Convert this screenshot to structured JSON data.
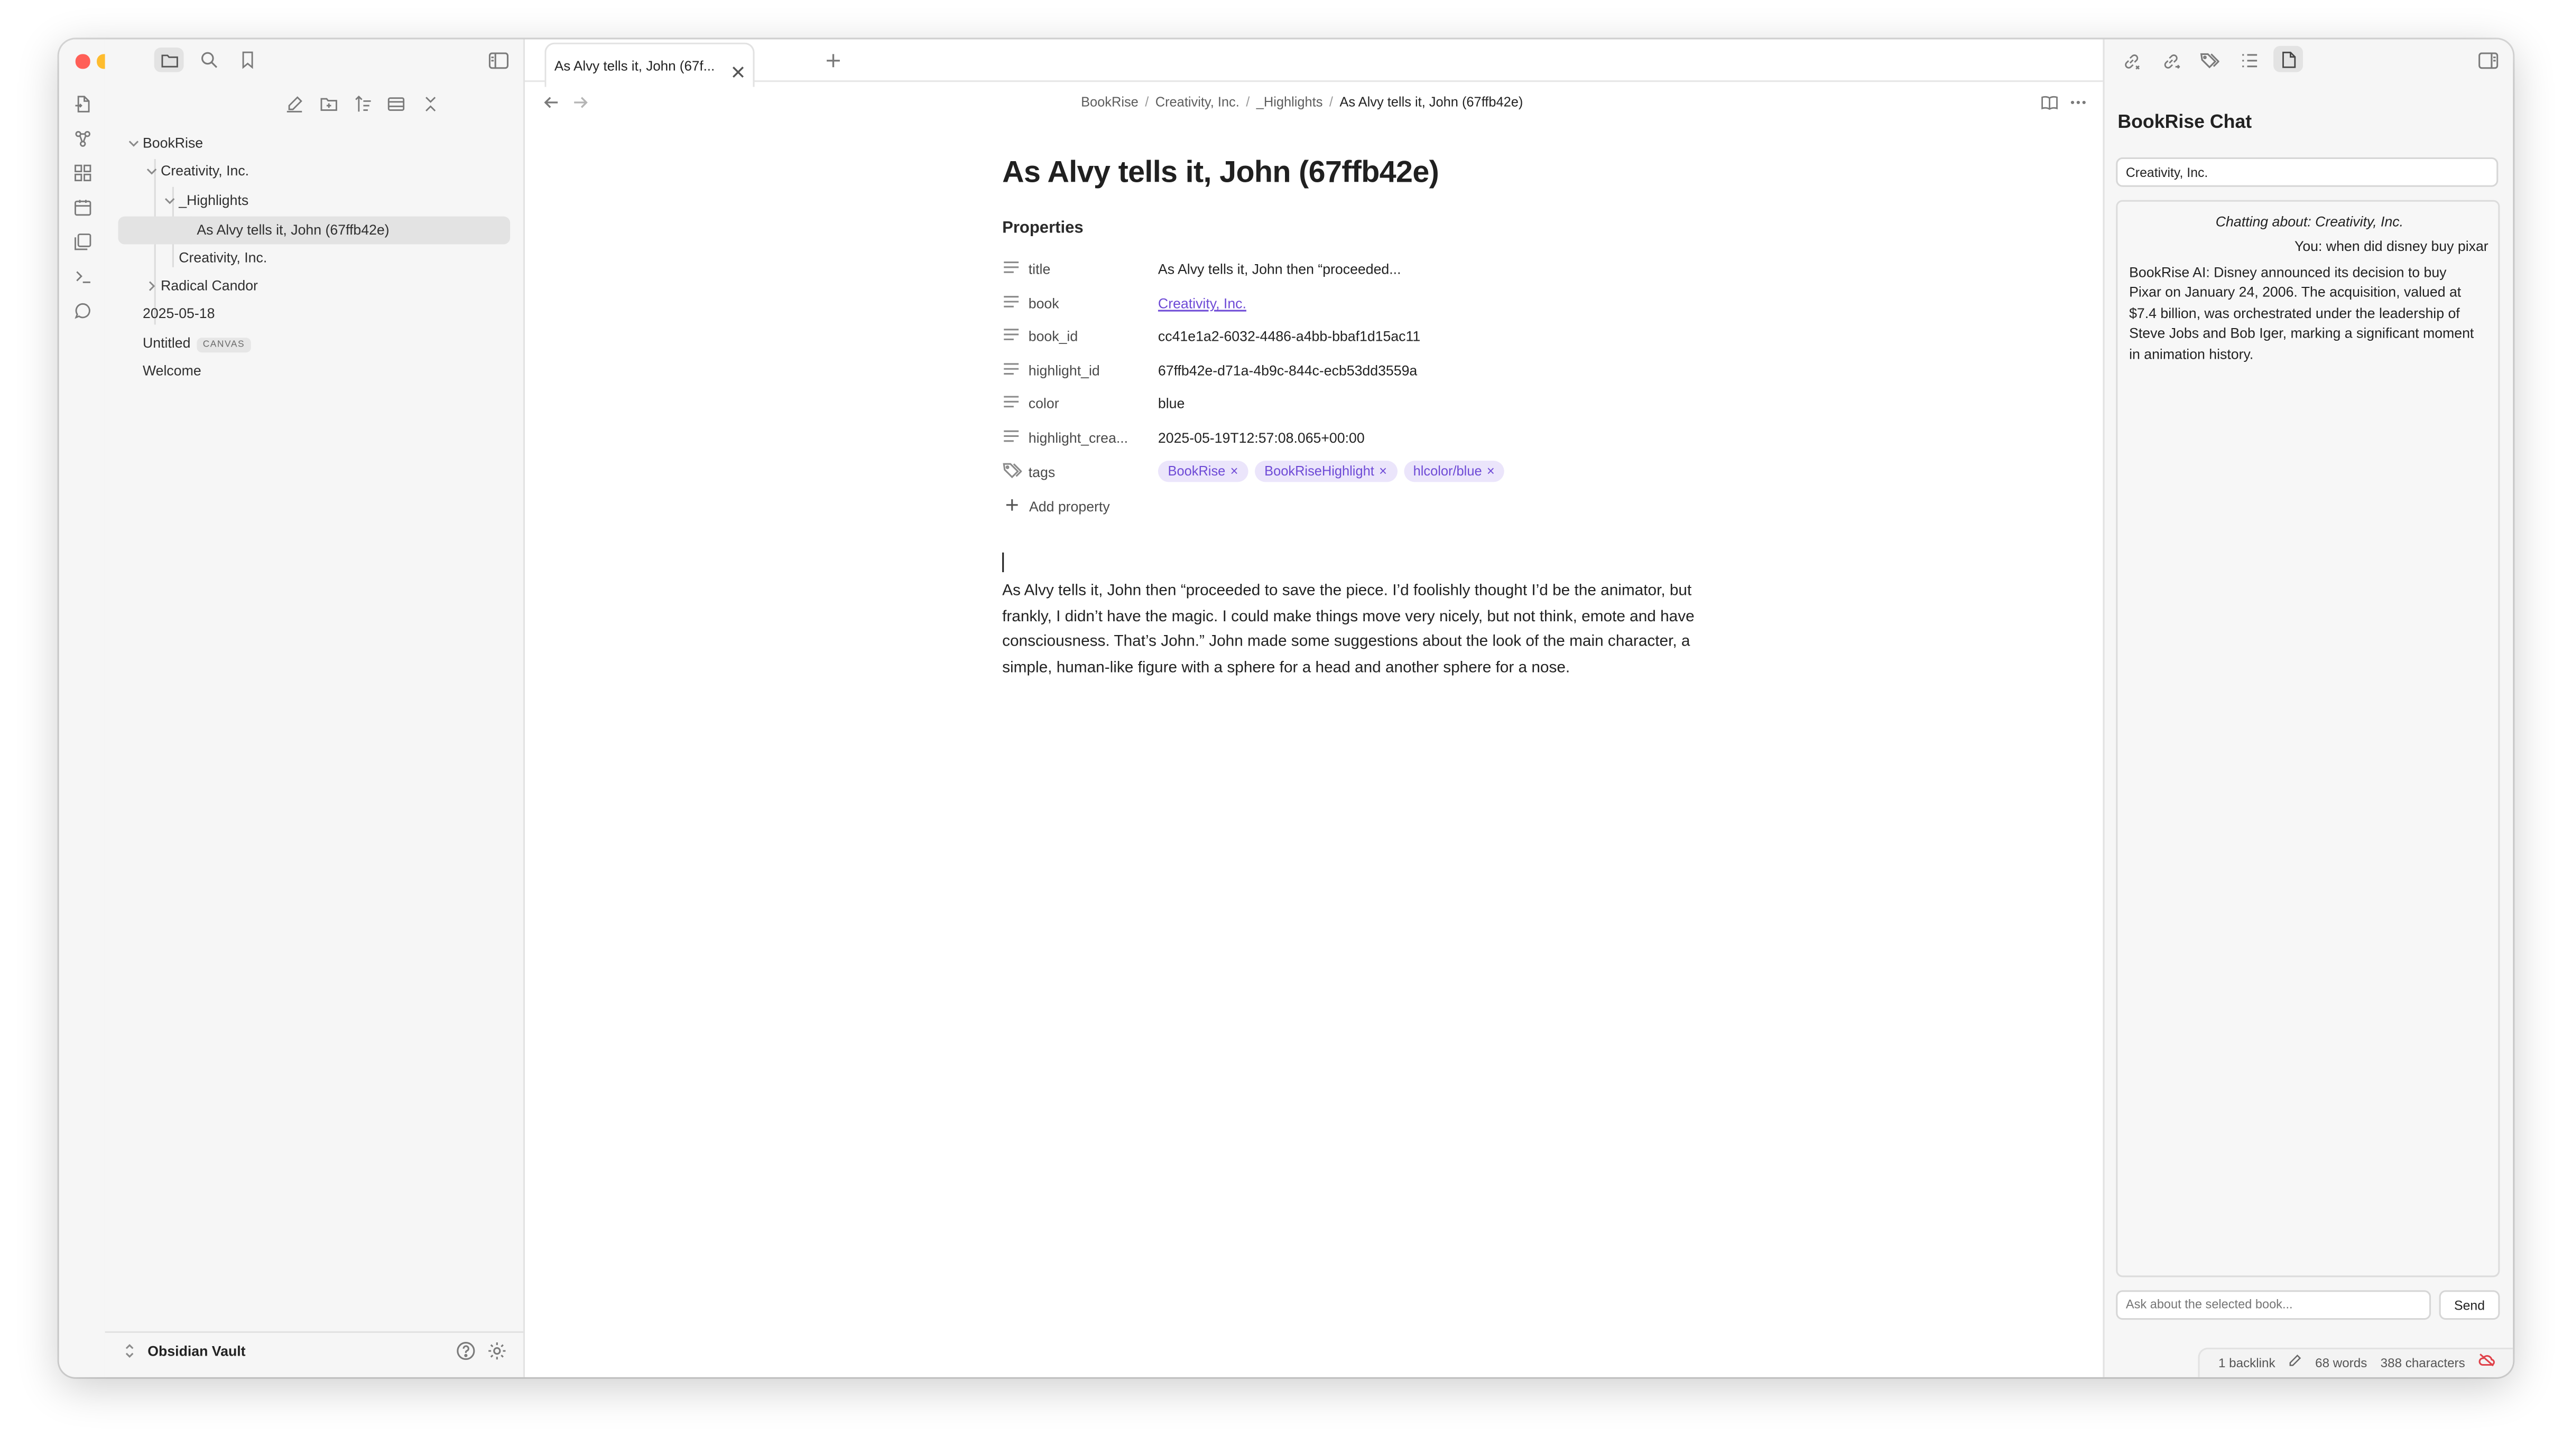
{
  "sidebar": {
    "tree": [
      {
        "label": "BookRise",
        "expanded": true
      },
      {
        "label": "Creativity, Inc.",
        "expanded": true
      },
      {
        "label": "_Highlights",
        "expanded": true
      },
      {
        "label": "As Alvy tells it, John (67ffb42e)",
        "active": true
      },
      {
        "label": "Creativity, Inc."
      },
      {
        "label": "Radical Candor",
        "expanded": false
      },
      {
        "label": "2025-05-18"
      },
      {
        "label": "Untitled",
        "badge": "CANVAS"
      },
      {
        "label": "Welcome"
      }
    ],
    "vault_name": "Obsidian Vault"
  },
  "tab": {
    "title": "As Alvy tells it, John (67f..."
  },
  "breadcrumb": [
    "BookRise",
    "Creativity, Inc.",
    "_Highlights",
    "As Alvy tells it, John (67ffb42e)"
  ],
  "note": {
    "title": "As Alvy tells it, John (67ffb42e)",
    "properties_heading": "Properties",
    "properties": [
      {
        "key": "title",
        "value": "As Alvy tells it, John then “proceeded..."
      },
      {
        "key": "book",
        "value": "Creativity, Inc."
      },
      {
        "key": "book_id",
        "value": "cc41e1a2-6032-4486-a4bb-bbaf1d15ac11"
      },
      {
        "key": "highlight_id",
        "value": "67ffb42e-d71a-4b9c-844c-ecb53dd3559a"
      },
      {
        "key": "color",
        "value": "blue"
      },
      {
        "key": "highlight_crea...",
        "value": "2025-05-19T12:57:08.065+00:00"
      },
      {
        "key": "tags",
        "value": ""
      }
    ],
    "tags": [
      "BookRise",
      "BookRiseHighlight",
      "hlcolor/blue"
    ],
    "add_property_label": "Add property",
    "body": "As Alvy tells it, John then “proceeded to save the piece. I’d foolishly thought I’d be the animator, but frankly, I didn’t have the magic. I could make things move very nicely, but not think, emote and have consciousness. That’s John.” John made some suggestions about the look of the main character, a simple, human-like figure with a sphere for a head and another sphere for a nose."
  },
  "chat": {
    "title": "BookRise Chat",
    "selected_book": "Creativity, Inc.",
    "about_text": "Chatting about: Creativity, Inc.",
    "user_message": "You: when did disney buy pixar",
    "ai_message": "BookRise AI: Disney announced its decision to buy Pixar on January 24, 2006. The acquisition, valued at $7.4 billion, was orchestrated under the leadership of Steve Jobs and Bob Iger, marking a significant moment in animation history.",
    "input_placeholder": "Ask about the selected book...",
    "send_label": "Send"
  },
  "status_bar": {
    "backlinks": "1 backlink",
    "words": "68 words",
    "characters": "388 characters"
  },
  "colors": {
    "accent": "#6e4ad6",
    "tag_bg": "#ebe5fb",
    "traffic_close": "#ff5f57",
    "traffic_min": "#febc2e",
    "traffic_max": "#28c840"
  },
  "icons": {
    "ribbon": [
      "file-open-icon",
      "graph-view-icon",
      "canvas-icon",
      "calendar-icon",
      "templates-icon",
      "command-palette-icon",
      "chat-icon"
    ],
    "sidebar_tabs": [
      "folder-icon",
      "search-icon",
      "bookmark-icon"
    ],
    "file_actions": [
      "new-note-icon",
      "new-folder-icon",
      "sort-icon",
      "collapse-toggle-icon",
      "collapse-all-icon"
    ],
    "right_tabs": [
      "backlinks-icon",
      "outgoing-links-icon",
      "tags-icon",
      "outline-icon",
      "file-icon"
    ]
  }
}
